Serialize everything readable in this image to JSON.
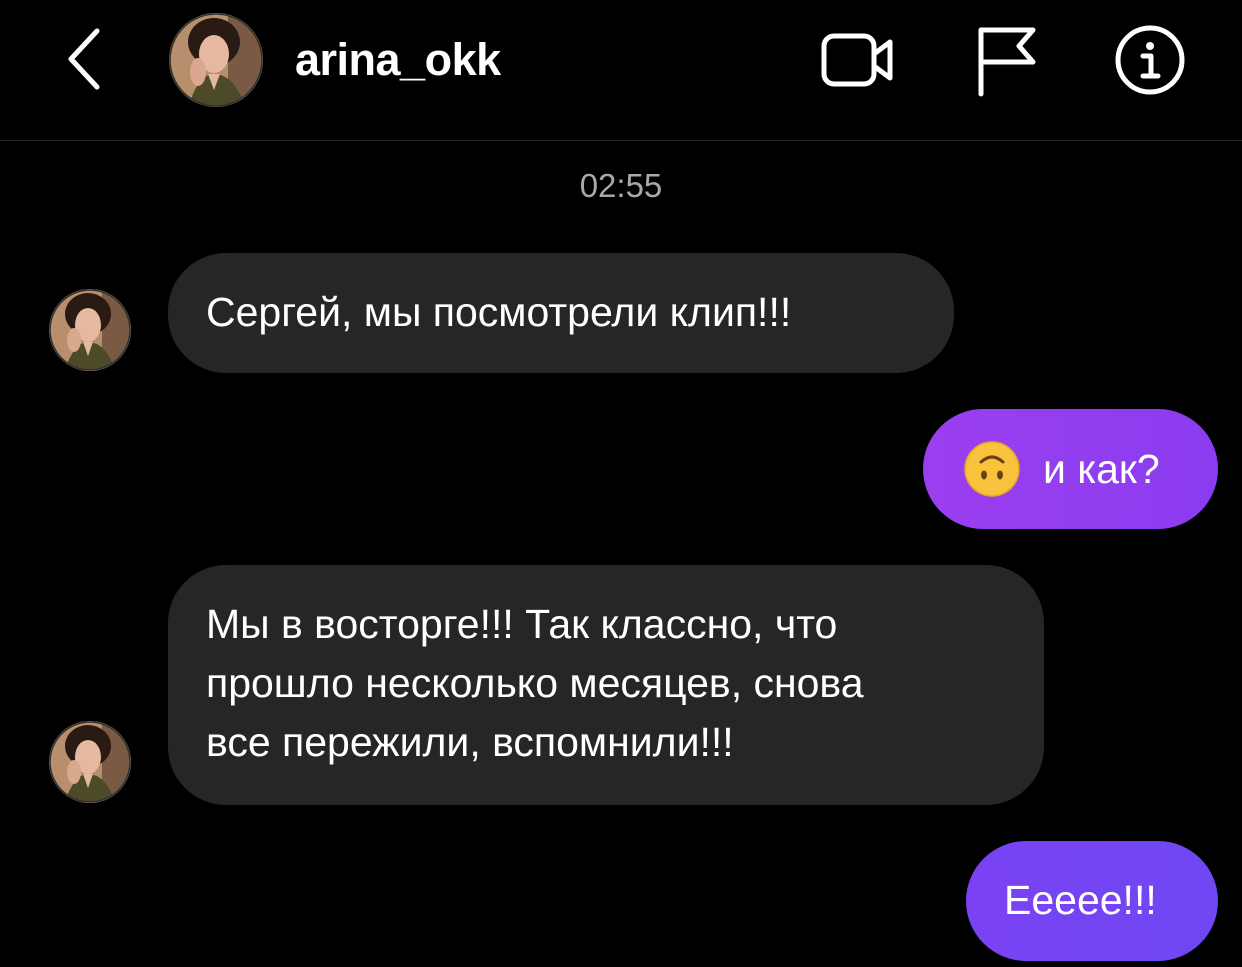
{
  "header": {
    "username": "arina_okk",
    "back_icon": "chevron-left-icon",
    "video_icon": "video-camera-icon",
    "flag_icon": "flag-icon",
    "info_icon": "info-icon"
  },
  "conversation": {
    "timestamp": "02:55",
    "messages": [
      {
        "direction": "incoming",
        "text": "Сергей, мы посмотрели клип!!!"
      },
      {
        "direction": "outgoing",
        "emoji": "upside-down-face-emoji",
        "text": "и как?"
      },
      {
        "direction": "incoming",
        "lines": [
          "Мы в восторге!!! Так классно, что",
          "прошло несколько месяцев, снова",
          "все пережили, вспомнили!!!"
        ]
      },
      {
        "direction": "outgoing",
        "text": "Ееeee!!!"
      }
    ]
  },
  "colors": {
    "background": "#000000",
    "incoming_bubble": "#262626",
    "outgoing_bubble_purple": "#9a3ff0",
    "outgoing_bubble_violet": "#6f47f3",
    "timestamp": "#a8a8a8"
  }
}
